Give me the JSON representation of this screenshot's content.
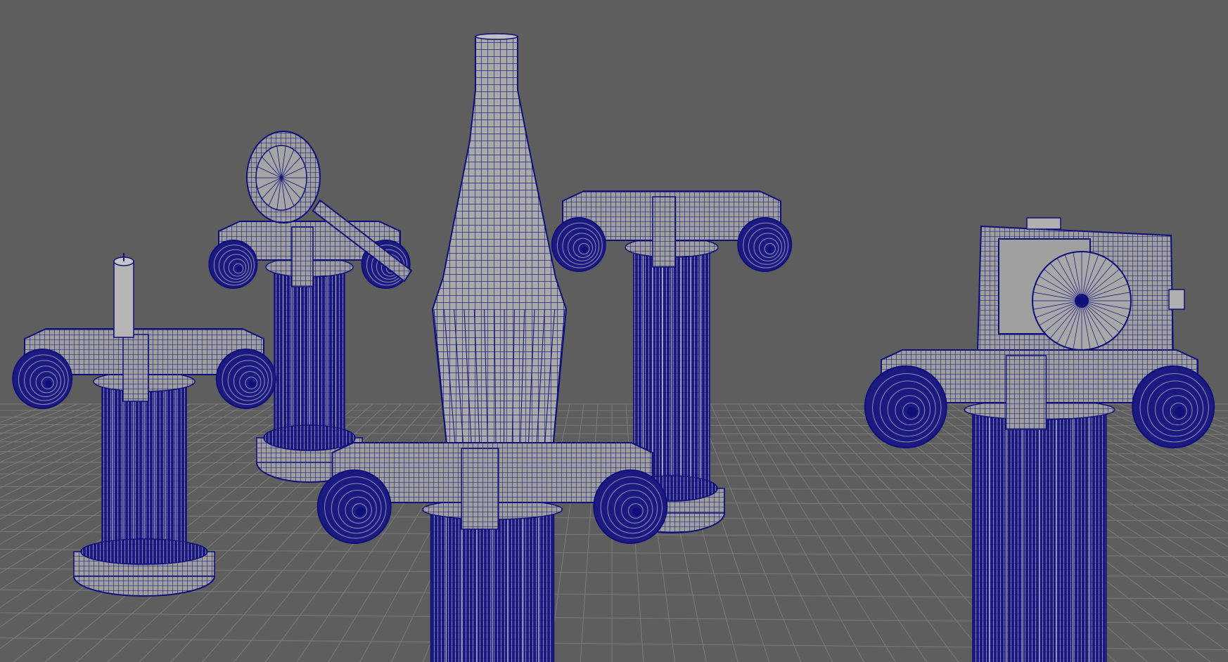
{
  "viewport": {
    "background": "#5e5e5e",
    "grid_color": "#7c7c7c",
    "wire_color": "#0f0f7a",
    "shade_color": "#a7a7a7",
    "shade_dark": "#8e8e8e"
  },
  "objects": [
    {
      "name": "column-left-front",
      "prop": "candle",
      "kind": "ionic-column"
    },
    {
      "name": "column-left-back",
      "prop": "magnifying-glass",
      "kind": "ionic-column"
    },
    {
      "name": "column-center-front",
      "prop": "bottle",
      "kind": "ionic-column"
    },
    {
      "name": "column-center-back",
      "prop": "none",
      "kind": "ionic-column"
    },
    {
      "name": "column-right",
      "prop": "camera",
      "kind": "ionic-column"
    }
  ]
}
